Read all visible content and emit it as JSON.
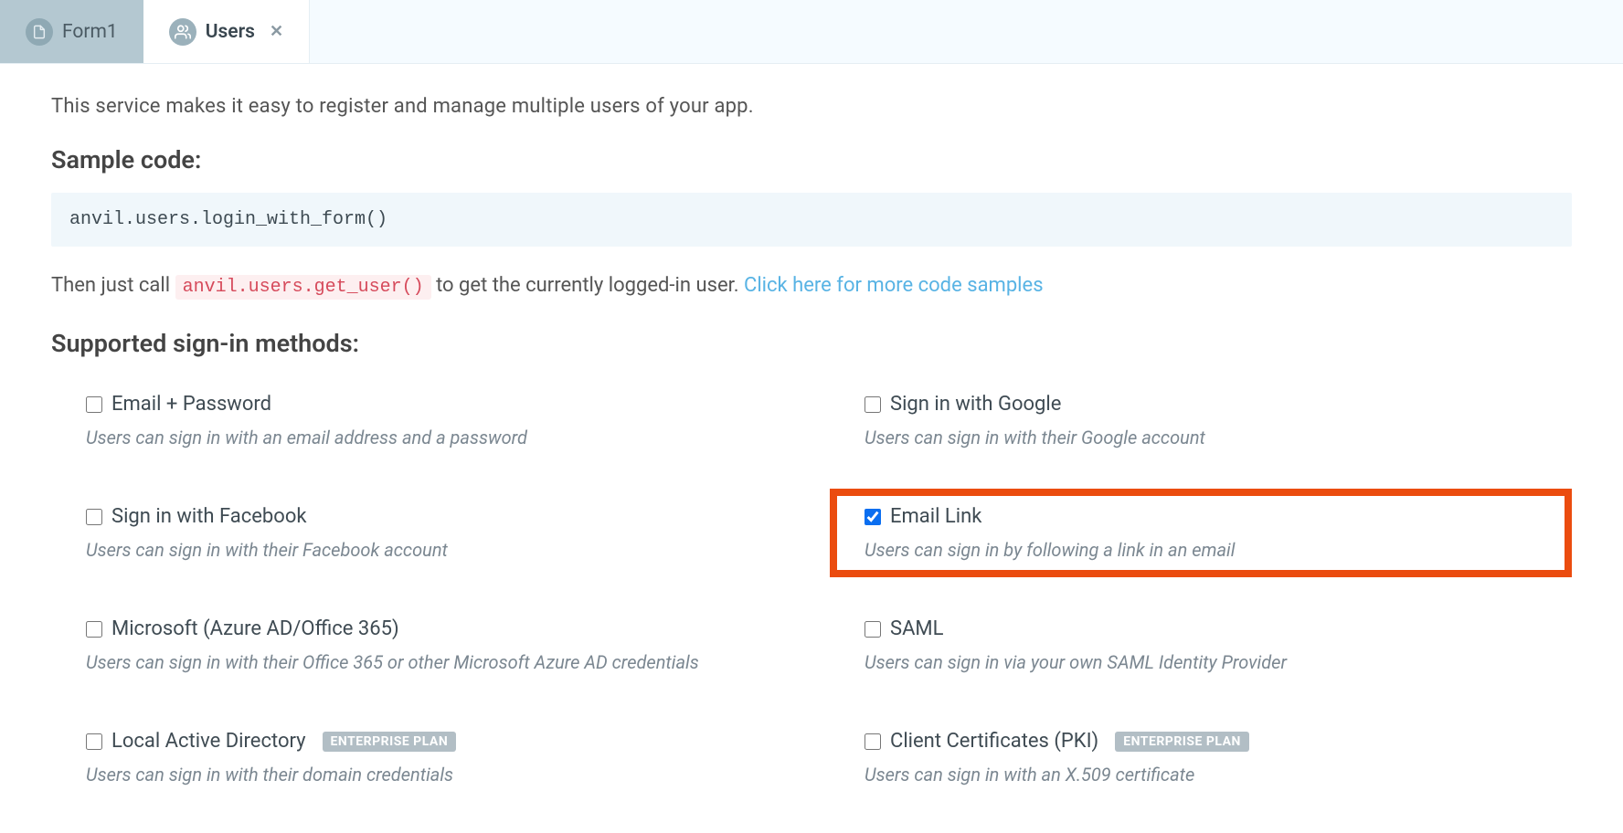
{
  "tabs": {
    "form1": {
      "label": "Form1"
    },
    "users": {
      "label": "Users"
    }
  },
  "content": {
    "intro": "This service makes it easy to register and manage multiple users of your app.",
    "sample_code_title": "Sample code:",
    "sample_code": "anvil.users.login_with_form()",
    "then_prefix": "Then just call ",
    "then_inline_code": "anvil.users.get_user()",
    "then_suffix": " to get the currently logged-in user. ",
    "then_link": "Click here for more code samples",
    "methods_title": "Supported sign-in methods:",
    "methods": {
      "email_password": {
        "label": "Email + Password",
        "desc": "Users can sign in with an email address and a password",
        "checked": false
      },
      "google": {
        "label": "Sign in with Google",
        "desc": "Users can sign in with their Google account",
        "checked": false
      },
      "facebook": {
        "label": "Sign in with Facebook",
        "desc": "Users can sign in with their Facebook account",
        "checked": false
      },
      "email_link": {
        "label": "Email Link",
        "desc": "Users can sign in by following a link in an email",
        "checked": true
      },
      "microsoft": {
        "label": "Microsoft (Azure AD/Office 365)",
        "desc": "Users can sign in with their Office 365 or other Microsoft Azure AD credentials",
        "checked": false
      },
      "saml": {
        "label": "SAML",
        "desc": "Users can sign in via your own SAML Identity Provider",
        "checked": false
      },
      "local_ad": {
        "label": "Local Active Directory",
        "desc": "Users can sign in with their domain credentials",
        "checked": false,
        "badge": "ENTERPRISE PLAN"
      },
      "client_certs": {
        "label": "Client Certificates (PKI)",
        "desc": "Users can sign in with an X.509 certificate",
        "checked": false,
        "badge": "ENTERPRISE PLAN"
      }
    }
  }
}
